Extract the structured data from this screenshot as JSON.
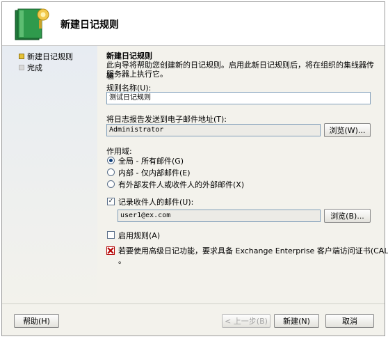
{
  "header": {
    "title": "新建日记规则"
  },
  "steps": [
    {
      "label": "新建日记规则",
      "state": "active"
    },
    {
      "label": "完成",
      "state": "pending"
    }
  ],
  "main": {
    "section_title": "新建日记规则",
    "intro_line1": "此向导将帮助您创建新的日记规则。启用此新日记规则后，将在组织的集线器传输",
    "intro_line2": "服务器上执行它。",
    "rule_name_label": "规则名称(U):",
    "rule_name_value": "测试日记规则",
    "email_label": "将日志报告发送到电子邮件地址(T):",
    "email_value": "Administrator",
    "browse1_label": "浏览(W)...",
    "scope_label": "作用域:",
    "scope_options": [
      {
        "label": "全局 - 所有邮件(G)",
        "checked": true
      },
      {
        "label": "内部 - 仅内部邮件(E)",
        "checked": false
      },
      {
        "label": "有外部发件人或收件人的外部邮件(X)",
        "checked": false
      }
    ],
    "record_recipient_label": "记录收件人的邮件(U):",
    "record_recipient_checked": true,
    "recipient_value": "user1@ex.com",
    "browse2_label": "浏览(B)...",
    "enable_rule_label": "启用规则(A)",
    "enable_rule_checked": false,
    "warning_text": "若要使用高级日记功能，要求具备 Exchange Enterprise 客户端访问证书(CAL)",
    "warning_tail": "。"
  },
  "footer": {
    "help_label": "帮助(H)",
    "back_label": "< 上一步(B)",
    "new_label": "新建(N)",
    "cancel_label": "取消"
  },
  "colors": {
    "accent": "#0c3e7a",
    "active_step": "#e6c236",
    "error": "#b40000"
  }
}
